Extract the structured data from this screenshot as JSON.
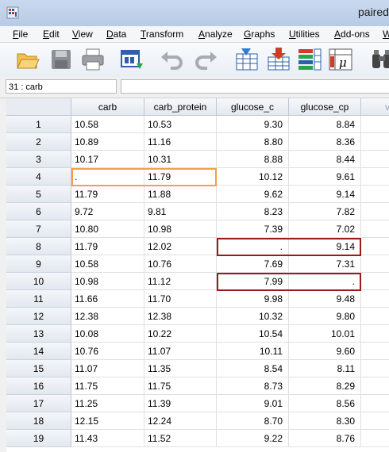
{
  "window": {
    "title": "paired"
  },
  "menu": [
    {
      "label": "File"
    },
    {
      "label": "Edit"
    },
    {
      "label": "View"
    },
    {
      "label": "Data"
    },
    {
      "label": "Transform"
    },
    {
      "label": "Analyze"
    },
    {
      "label": "Graphs"
    },
    {
      "label": "Utilities"
    },
    {
      "label": "Add-ons"
    },
    {
      "label": "W"
    }
  ],
  "toolbar": {
    "buttons": [
      "open-icon",
      "save-icon",
      "print-icon",
      "dialog-recall-icon",
      "undo-icon",
      "redo-icon",
      "goto-case-icon",
      "goto-variable-icon",
      "variables-icon",
      "statistics-icon",
      "find-icon"
    ]
  },
  "refbar": {
    "cell_ref": "31 : carb",
    "value": ""
  },
  "columns": [
    "carb",
    "carb_protein",
    "glucose_c",
    "glucose_cp",
    "va"
  ],
  "rows": [
    {
      "n": "1",
      "cells": [
        "10.58",
        "10.53",
        "9.30",
        "8.84"
      ]
    },
    {
      "n": "2",
      "cells": [
        "10.89",
        "11.16",
        "8.80",
        "8.36"
      ]
    },
    {
      "n": "3",
      "cells": [
        "10.17",
        "10.31",
        "8.88",
        "8.44"
      ]
    },
    {
      "n": "4",
      "cells": [
        ".",
        "11.79",
        "10.12",
        "9.61"
      ]
    },
    {
      "n": "5",
      "cells": [
        "11.79",
        "11.88",
        "9.62",
        "9.14"
      ]
    },
    {
      "n": "6",
      "cells": [
        "9.72",
        "9.81",
        "8.23",
        "7.82"
      ]
    },
    {
      "n": "7",
      "cells": [
        "10.80",
        "10.98",
        "7.39",
        "7.02"
      ]
    },
    {
      "n": "8",
      "cells": [
        "11.79",
        "12.02",
        ".",
        "9.14"
      ]
    },
    {
      "n": "9",
      "cells": [
        "10.58",
        "10.76",
        "7.69",
        "7.31"
      ]
    },
    {
      "n": "10",
      "cells": [
        "10.98",
        "11.12",
        "7.99",
        "."
      ]
    },
    {
      "n": "11",
      "cells": [
        "11.66",
        "11.70",
        "9.98",
        "9.48"
      ]
    },
    {
      "n": "12",
      "cells": [
        "12.38",
        "12.38",
        "10.32",
        "9.80"
      ]
    },
    {
      "n": "13",
      "cells": [
        "10.08",
        "10.22",
        "10.54",
        "10.01"
      ]
    },
    {
      "n": "14",
      "cells": [
        "10.76",
        "11.07",
        "10.11",
        "9.60"
      ]
    },
    {
      "n": "15",
      "cells": [
        "11.07",
        "11.35",
        "8.54",
        "8.11"
      ]
    },
    {
      "n": "16",
      "cells": [
        "11.75",
        "11.75",
        "8.73",
        "8.29"
      ]
    },
    {
      "n": "17",
      "cells": [
        "11.25",
        "11.39",
        "9.01",
        "8.56"
      ]
    },
    {
      "n": "18",
      "cells": [
        "12.15",
        "12.24",
        "8.70",
        "8.30"
      ]
    },
    {
      "n": "19",
      "cells": [
        "11.43",
        "11.52",
        "9.22",
        "8.76"
      ]
    }
  ],
  "colors": {
    "highlight_missing_carb": "#f0a04a",
    "highlight_missing_glucose": "#9b1b1b"
  }
}
